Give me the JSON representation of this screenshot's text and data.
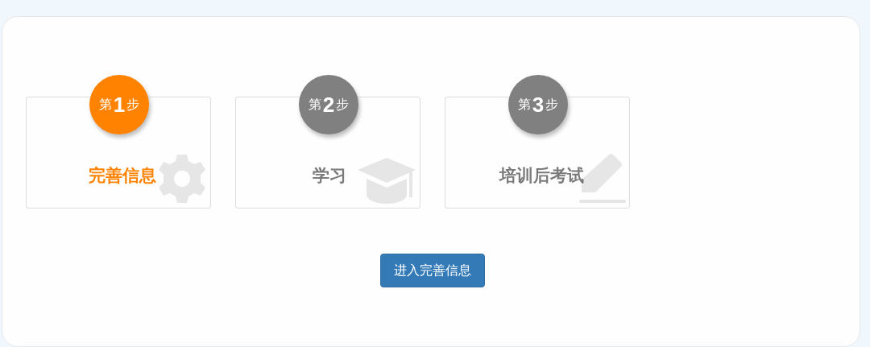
{
  "steps": [
    {
      "prefix": "第",
      "number": "1",
      "suffix": "步",
      "title": "完善信息",
      "current": true
    },
    {
      "prefix": "第",
      "number": "2",
      "suffix": "步",
      "title": "学习",
      "current": false
    },
    {
      "prefix": "第",
      "number": "3",
      "suffix": "步",
      "title": "培训后考试",
      "current": false
    }
  ],
  "action_button": {
    "label": "进入完善信息"
  }
}
